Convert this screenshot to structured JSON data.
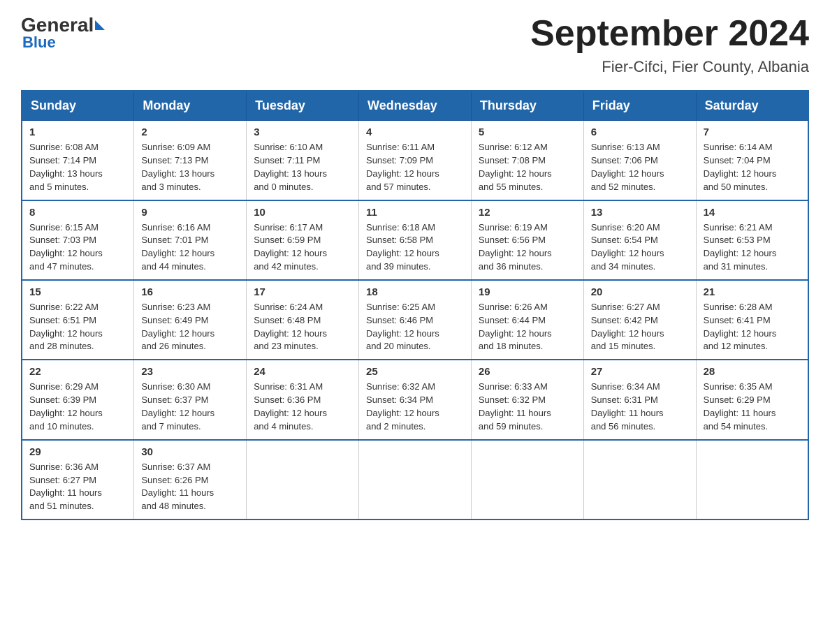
{
  "header": {
    "logo_general": "General",
    "logo_blue": "Blue",
    "title": "September 2024",
    "subtitle": "Fier-Cifci, Fier County, Albania"
  },
  "weekdays": [
    "Sunday",
    "Monday",
    "Tuesday",
    "Wednesday",
    "Thursday",
    "Friday",
    "Saturday"
  ],
  "weeks": [
    [
      {
        "day": "1",
        "info": "Sunrise: 6:08 AM\nSunset: 7:14 PM\nDaylight: 13 hours\nand 5 minutes."
      },
      {
        "day": "2",
        "info": "Sunrise: 6:09 AM\nSunset: 7:13 PM\nDaylight: 13 hours\nand 3 minutes."
      },
      {
        "day": "3",
        "info": "Sunrise: 6:10 AM\nSunset: 7:11 PM\nDaylight: 13 hours\nand 0 minutes."
      },
      {
        "day": "4",
        "info": "Sunrise: 6:11 AM\nSunset: 7:09 PM\nDaylight: 12 hours\nand 57 minutes."
      },
      {
        "day": "5",
        "info": "Sunrise: 6:12 AM\nSunset: 7:08 PM\nDaylight: 12 hours\nand 55 minutes."
      },
      {
        "day": "6",
        "info": "Sunrise: 6:13 AM\nSunset: 7:06 PM\nDaylight: 12 hours\nand 52 minutes."
      },
      {
        "day": "7",
        "info": "Sunrise: 6:14 AM\nSunset: 7:04 PM\nDaylight: 12 hours\nand 50 minutes."
      }
    ],
    [
      {
        "day": "8",
        "info": "Sunrise: 6:15 AM\nSunset: 7:03 PM\nDaylight: 12 hours\nand 47 minutes."
      },
      {
        "day": "9",
        "info": "Sunrise: 6:16 AM\nSunset: 7:01 PM\nDaylight: 12 hours\nand 44 minutes."
      },
      {
        "day": "10",
        "info": "Sunrise: 6:17 AM\nSunset: 6:59 PM\nDaylight: 12 hours\nand 42 minutes."
      },
      {
        "day": "11",
        "info": "Sunrise: 6:18 AM\nSunset: 6:58 PM\nDaylight: 12 hours\nand 39 minutes."
      },
      {
        "day": "12",
        "info": "Sunrise: 6:19 AM\nSunset: 6:56 PM\nDaylight: 12 hours\nand 36 minutes."
      },
      {
        "day": "13",
        "info": "Sunrise: 6:20 AM\nSunset: 6:54 PM\nDaylight: 12 hours\nand 34 minutes."
      },
      {
        "day": "14",
        "info": "Sunrise: 6:21 AM\nSunset: 6:53 PM\nDaylight: 12 hours\nand 31 minutes."
      }
    ],
    [
      {
        "day": "15",
        "info": "Sunrise: 6:22 AM\nSunset: 6:51 PM\nDaylight: 12 hours\nand 28 minutes."
      },
      {
        "day": "16",
        "info": "Sunrise: 6:23 AM\nSunset: 6:49 PM\nDaylight: 12 hours\nand 26 minutes."
      },
      {
        "day": "17",
        "info": "Sunrise: 6:24 AM\nSunset: 6:48 PM\nDaylight: 12 hours\nand 23 minutes."
      },
      {
        "day": "18",
        "info": "Sunrise: 6:25 AM\nSunset: 6:46 PM\nDaylight: 12 hours\nand 20 minutes."
      },
      {
        "day": "19",
        "info": "Sunrise: 6:26 AM\nSunset: 6:44 PM\nDaylight: 12 hours\nand 18 minutes."
      },
      {
        "day": "20",
        "info": "Sunrise: 6:27 AM\nSunset: 6:42 PM\nDaylight: 12 hours\nand 15 minutes."
      },
      {
        "day": "21",
        "info": "Sunrise: 6:28 AM\nSunset: 6:41 PM\nDaylight: 12 hours\nand 12 minutes."
      }
    ],
    [
      {
        "day": "22",
        "info": "Sunrise: 6:29 AM\nSunset: 6:39 PM\nDaylight: 12 hours\nand 10 minutes."
      },
      {
        "day": "23",
        "info": "Sunrise: 6:30 AM\nSunset: 6:37 PM\nDaylight: 12 hours\nand 7 minutes."
      },
      {
        "day": "24",
        "info": "Sunrise: 6:31 AM\nSunset: 6:36 PM\nDaylight: 12 hours\nand 4 minutes."
      },
      {
        "day": "25",
        "info": "Sunrise: 6:32 AM\nSunset: 6:34 PM\nDaylight: 12 hours\nand 2 minutes."
      },
      {
        "day": "26",
        "info": "Sunrise: 6:33 AM\nSunset: 6:32 PM\nDaylight: 11 hours\nand 59 minutes."
      },
      {
        "day": "27",
        "info": "Sunrise: 6:34 AM\nSunset: 6:31 PM\nDaylight: 11 hours\nand 56 minutes."
      },
      {
        "day": "28",
        "info": "Sunrise: 6:35 AM\nSunset: 6:29 PM\nDaylight: 11 hours\nand 54 minutes."
      }
    ],
    [
      {
        "day": "29",
        "info": "Sunrise: 6:36 AM\nSunset: 6:27 PM\nDaylight: 11 hours\nand 51 minutes."
      },
      {
        "day": "30",
        "info": "Sunrise: 6:37 AM\nSunset: 6:26 PM\nDaylight: 11 hours\nand 48 minutes."
      },
      {
        "day": "",
        "info": ""
      },
      {
        "day": "",
        "info": ""
      },
      {
        "day": "",
        "info": ""
      },
      {
        "day": "",
        "info": ""
      },
      {
        "day": "",
        "info": ""
      }
    ]
  ]
}
